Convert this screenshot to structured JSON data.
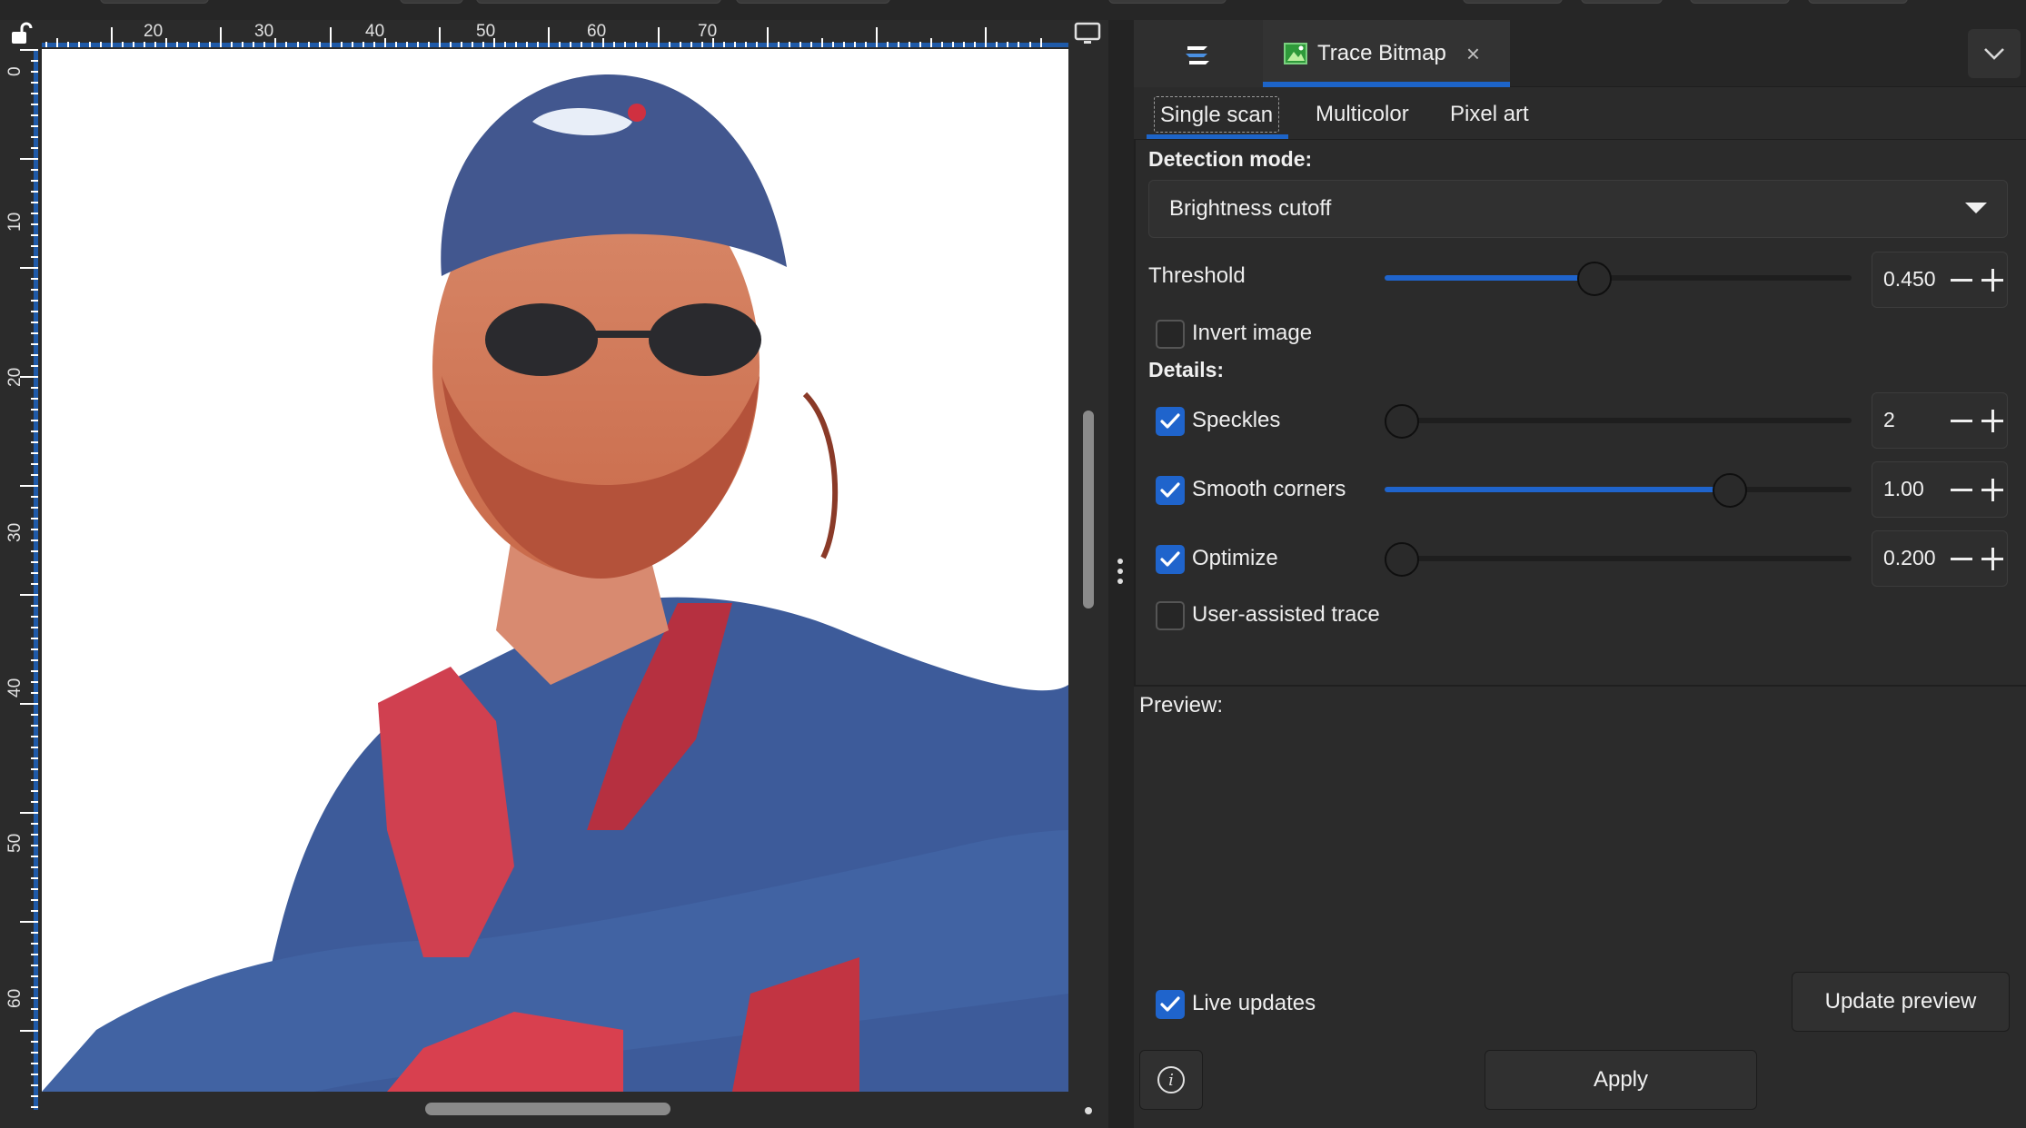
{
  "canvas": {
    "ruler_h_labels": [
      "20",
      "30",
      "40",
      "50",
      "60",
      "70"
    ],
    "ruler_v_labels": [
      "0",
      "10",
      "20",
      "30",
      "40",
      "50",
      "60"
    ],
    "icons": {
      "lock": "lock-icon",
      "display": "display-icon"
    }
  },
  "dock": {
    "menu_icon": "dialog-menu-icon",
    "tab": {
      "title": "Trace Bitmap",
      "icon": "trace-bitmap-icon",
      "close": "×"
    },
    "chevron": "chevron-down-icon"
  },
  "trace": {
    "subtabs": [
      "Single scan",
      "Multicolor",
      "Pixel art"
    ],
    "active_subtab": "Single scan",
    "detection_mode_label": "Detection mode:",
    "detection_mode_value": "Brightness cutoff",
    "threshold": {
      "label": "Threshold",
      "value": "0.450",
      "fraction": 0.45
    },
    "invert_image": {
      "label": "Invert image",
      "checked": false
    },
    "details_label": "Details:",
    "speckles": {
      "label": "Speckles",
      "value": "2",
      "checked": true,
      "fraction": 0.0
    },
    "smooth_corners": {
      "label": "Smooth corners",
      "value": "1.00",
      "checked": true,
      "fraction": 0.74
    },
    "optimize": {
      "label": "Optimize",
      "value": "0.200",
      "checked": true,
      "fraction": 0.0
    },
    "user_assisted": {
      "label": "User-assisted trace",
      "checked": false
    }
  },
  "preview": {
    "label": "Preview:",
    "live_updates": {
      "label": "Live updates",
      "checked": true
    },
    "update_button": "Update preview"
  },
  "footer": {
    "info_icon": "info-icon",
    "apply_button": "Apply"
  },
  "colors": {
    "accent": "#1f64cc",
    "panel_bg": "#2b2b2b",
    "ruler_blue": "#1f5aa8"
  }
}
